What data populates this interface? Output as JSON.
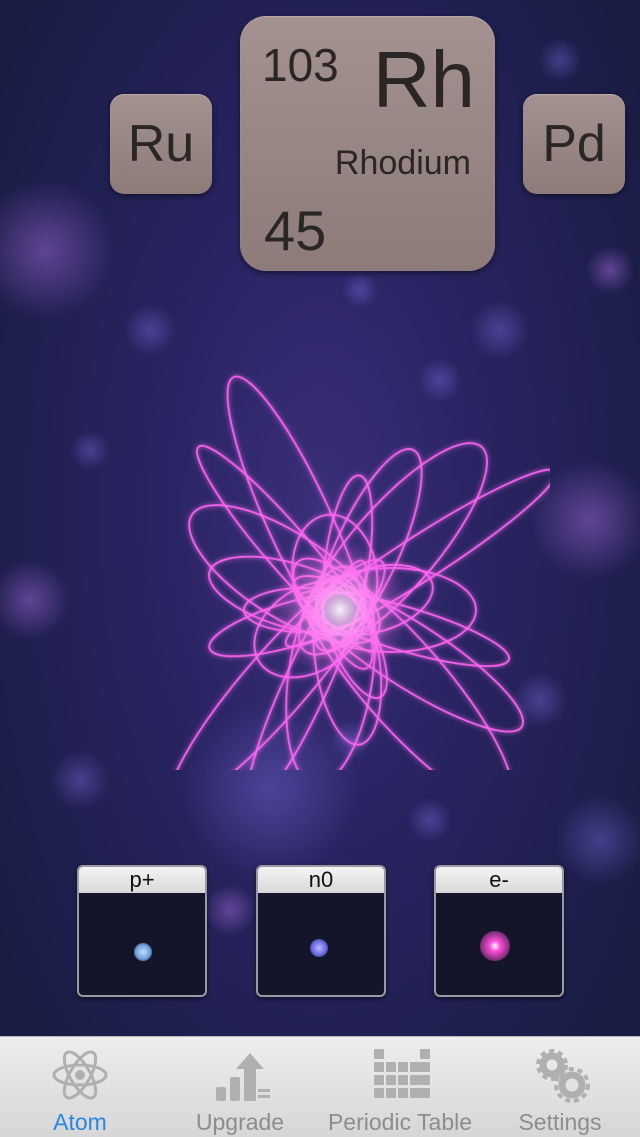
{
  "element_tiles": {
    "previous": {
      "symbol": "Ru"
    },
    "current": {
      "mass": "103",
      "symbol": "Rh",
      "name": "Rhodium",
      "atomic_number": "45"
    },
    "next": {
      "symbol": "Pd"
    }
  },
  "particles": [
    {
      "label": "p+",
      "color": "#6f9fd8"
    },
    {
      "label": "n0",
      "color": "#6a6ae0"
    },
    {
      "label": "e-",
      "color": "#ff4fd8"
    }
  ],
  "tabbar": {
    "atom": "Atom",
    "upgrade": "Upgrade",
    "periodic_table": "Periodic Table",
    "settings": "Settings"
  },
  "colors": {
    "accent": "#2a86e0",
    "glow": "#ff5cf0",
    "tile": "#9b8a87"
  }
}
